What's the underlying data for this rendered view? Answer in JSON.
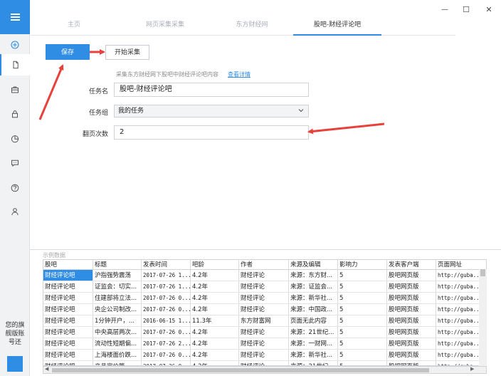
{
  "window": {
    "minimize_label": "—",
    "maximize_label": "☐",
    "close_label": "✕"
  },
  "tabs": [
    {
      "label": "主页"
    },
    {
      "label": "网页采集采集"
    },
    {
      "label": "东方财经网"
    },
    {
      "label": "股吧-财经评论吧"
    }
  ],
  "sidebar": {
    "icons": [
      "menu-icon",
      "add-circle-icon",
      "document-icon",
      "briefcase-icon",
      "lock-icon",
      "pie-chart-icon",
      "chat-icon",
      "help-icon",
      "user-icon"
    ],
    "note": "您的旗舰版账号还"
  },
  "toolbar": {
    "save_label": "保存",
    "start_label": "开始采集"
  },
  "form": {
    "description": "采集东方财经网下股吧中财经评论吧内容",
    "details_link": "查看详情",
    "task_name_label": "任务名",
    "task_name_value": "股吧-财经评论吧",
    "task_group_label": "任务组",
    "task_group_value": "我的任务",
    "page_turn_label": "翻页次数",
    "page_turn_value": "2"
  },
  "sample": {
    "title": "示例数据",
    "columns": [
      "股吧",
      "标题",
      "发表时间",
      "吧龄",
      "作者",
      "来源及编辑",
      "影响力",
      "发表客户端",
      "页面网址"
    ],
    "rows": [
      [
        "财经评论吧",
        "沪指强势震荡",
        "2017-07-26 1...",
        "4.2年",
        "财经评论",
        "来源：东方财...",
        "5",
        "股吧网页版",
        "http://guba...."
      ],
      [
        "财经评论吧",
        "证监会：切实...",
        "2017-07-26 1...",
        "4.2年",
        "财经评论",
        "来源：证监会...",
        "5",
        "股吧网页版",
        "http://guba...."
      ],
      [
        "财经评论吧",
        "住建部将立法...",
        "2017-07-26 0...",
        "4.2年",
        "财经评论",
        "来源：新华社...",
        "5",
        "股吧网页版",
        "http://guba...."
      ],
      [
        "财经评论吧",
        "央企公司制改...",
        "2017-07-26 0...",
        "4.2年",
        "财经评论",
        "来源：中国政...",
        "5",
        "股吧网页版",
        "http://guba...."
      ],
      [
        "财经评论吧",
        "1分钟开户，...",
        "2016-06-15 1...",
        "11.3年",
        "东方财富网",
        "页面无此内容",
        "5",
        "股吧网页版",
        "http://guba...."
      ],
      [
        "财经评论吧",
        "中央高层两次...",
        "2017-07-26 0...",
        "4.2年",
        "财经评论",
        "来源：21世纪...",
        "5",
        "股吧网页版",
        "http://guba...."
      ],
      [
        "财经评论吧",
        "流动性短期偏...",
        "2017-07-26 2...",
        "4.2年",
        "财经评论",
        "来源：一财网...",
        "5",
        "股吧网页版",
        "http://guba...."
      ],
      [
        "财经评论吧",
        "上海楼面价跌...",
        "2017-07-26 0...",
        "4.2年",
        "财经评论",
        "来源：新华社...",
        "5",
        "股吧网页版",
        "http://guba...."
      ],
      [
        "财经评论吧",
        "产品定价策... ",
        "2017-07-26 0...",
        "4.2年",
        "财经评论",
        "来源：21世纪...",
        "5",
        "股吧网页版",
        "http://guba...."
      ]
    ]
  },
  "colors": {
    "accent": "#2f8de4",
    "arrow": "#e8413b",
    "sidebar_bg": "#f1f2f4"
  }
}
